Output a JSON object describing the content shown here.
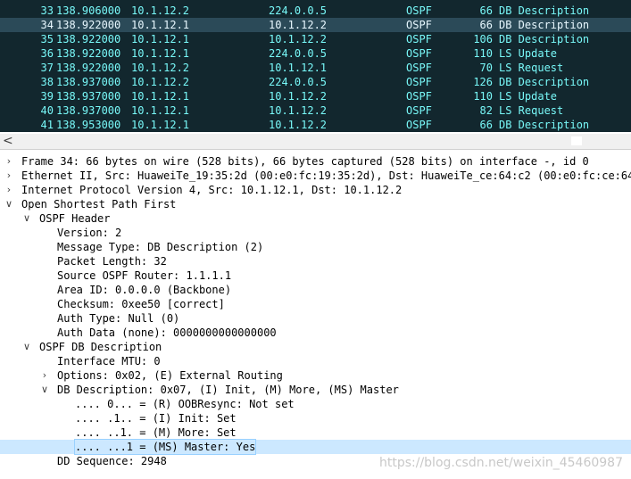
{
  "packets": [
    {
      "no": "33",
      "time": "138.906000",
      "src": "10.1.12.2",
      "dst": "224.0.0.5",
      "proto": "OSPF",
      "len": "66",
      "info": "DB Description"
    },
    {
      "no": "34",
      "time": "138.922000",
      "src": "10.1.12.1",
      "dst": "10.1.12.2",
      "proto": "OSPF",
      "len": "66",
      "info": "DB Description",
      "selected": true
    },
    {
      "no": "35",
      "time": "138.922000",
      "src": "10.1.12.1",
      "dst": "10.1.12.2",
      "proto": "OSPF",
      "len": "106",
      "info": "DB Description"
    },
    {
      "no": "36",
      "time": "138.922000",
      "src": "10.1.12.1",
      "dst": "224.0.0.5",
      "proto": "OSPF",
      "len": "110",
      "info": "LS Update"
    },
    {
      "no": "37",
      "time": "138.922000",
      "src": "10.1.12.2",
      "dst": "10.1.12.1",
      "proto": "OSPF",
      "len": "70",
      "info": "LS Request"
    },
    {
      "no": "38",
      "time": "138.937000",
      "src": "10.1.12.2",
      "dst": "224.0.0.5",
      "proto": "OSPF",
      "len": "126",
      "info": "DB Description"
    },
    {
      "no": "39",
      "time": "138.937000",
      "src": "10.1.12.1",
      "dst": "10.1.12.2",
      "proto": "OSPF",
      "len": "110",
      "info": "LS Update"
    },
    {
      "no": "40",
      "time": "138.937000",
      "src": "10.1.12.1",
      "dst": "10.1.12.2",
      "proto": "OSPF",
      "len": "82",
      "info": "LS Request"
    },
    {
      "no": "41",
      "time": "138.953000",
      "src": "10.1.12.1",
      "dst": "10.1.12.2",
      "proto": "OSPF",
      "len": "66",
      "info": "DB Description"
    }
  ],
  "scrollbar": {
    "left_arrow": "<"
  },
  "details": [
    {
      "depth": 0,
      "expander": "collapsed",
      "text": "Frame 34: 66 bytes on wire (528 bits), 66 bytes captured (528 bits) on interface -, id 0"
    },
    {
      "depth": 0,
      "expander": "collapsed",
      "text": "Ethernet II, Src: HuaweiTe_19:35:2d (00:e0:fc:19:35:2d), Dst: HuaweiTe_ce:64:c2 (00:e0:fc:ce:64:c2"
    },
    {
      "depth": 0,
      "expander": "collapsed",
      "text": "Internet Protocol Version 4, Src: 10.1.12.1, Dst: 10.1.12.2"
    },
    {
      "depth": 0,
      "expander": "expanded",
      "text": "Open Shortest Path First"
    },
    {
      "depth": 1,
      "expander": "expanded",
      "text": "OSPF Header"
    },
    {
      "depth": 2,
      "expander": "none",
      "text": "Version: 2"
    },
    {
      "depth": 2,
      "expander": "none",
      "text": "Message Type: DB Description (2)"
    },
    {
      "depth": 2,
      "expander": "none",
      "text": "Packet Length: 32"
    },
    {
      "depth": 2,
      "expander": "none",
      "text": "Source OSPF Router: 1.1.1.1"
    },
    {
      "depth": 2,
      "expander": "none",
      "text": "Area ID: 0.0.0.0 (Backbone)"
    },
    {
      "depth": 2,
      "expander": "none",
      "text": "Checksum: 0xee50 [correct]"
    },
    {
      "depth": 2,
      "expander": "none",
      "text": "Auth Type: Null (0)"
    },
    {
      "depth": 2,
      "expander": "none",
      "text": "Auth Data (none): 0000000000000000"
    },
    {
      "depth": 1,
      "expander": "expanded",
      "text": "OSPF DB Description"
    },
    {
      "depth": 2,
      "expander": "none",
      "text": "Interface MTU: 0"
    },
    {
      "depth": 2,
      "expander": "collapsed",
      "text": "Options: 0x02, (E) External Routing"
    },
    {
      "depth": 2,
      "expander": "expanded",
      "text": "DB Description: 0x07, (I) Init, (M) More, (MS) Master"
    },
    {
      "depth": 3,
      "expander": "none",
      "text": ".... 0... = (R) OOBResync: Not set"
    },
    {
      "depth": 3,
      "expander": "none",
      "text": ".... .1.. = (I) Init: Set"
    },
    {
      "depth": 3,
      "expander": "none",
      "text": ".... ..1. = (M) More: Set"
    },
    {
      "depth": 3,
      "expander": "none",
      "text": ".... ...1 = (MS) Master: Yes",
      "selected": true
    },
    {
      "depth": 2,
      "expander": "none",
      "text": "DD Sequence: 2948"
    }
  ],
  "watermark": "https://blog.csdn.net/weixin_45460987",
  "colors": {
    "list_bg": "#12272e",
    "list_text": "#78f8f8",
    "list_selected_bg": "#2b4a58",
    "detail_selected_bg": "#cce8ff"
  },
  "icons": {
    "collapsed": "chevron-right-icon",
    "expanded": "chevron-down-icon",
    "scroll_left": "scroll-left-arrow-icon"
  }
}
